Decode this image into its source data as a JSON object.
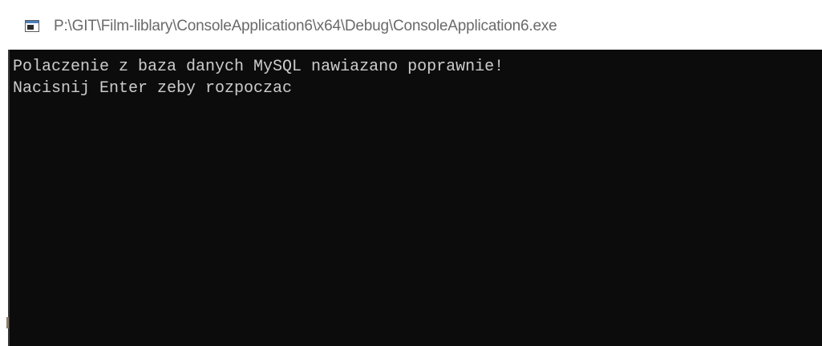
{
  "window": {
    "title": "P:\\GIT\\Film-liblary\\ConsoleApplication6\\x64\\Debug\\ConsoleApplication6.exe",
    "icon": "console-app-icon"
  },
  "console": {
    "lines": [
      "Polaczenie z baza danych MySQL nawiazano poprawnie!",
      "Nacisnij Enter zeby rozpoczac"
    ],
    "background_color": "#0c0c0c",
    "text_color": "#cccccc"
  }
}
